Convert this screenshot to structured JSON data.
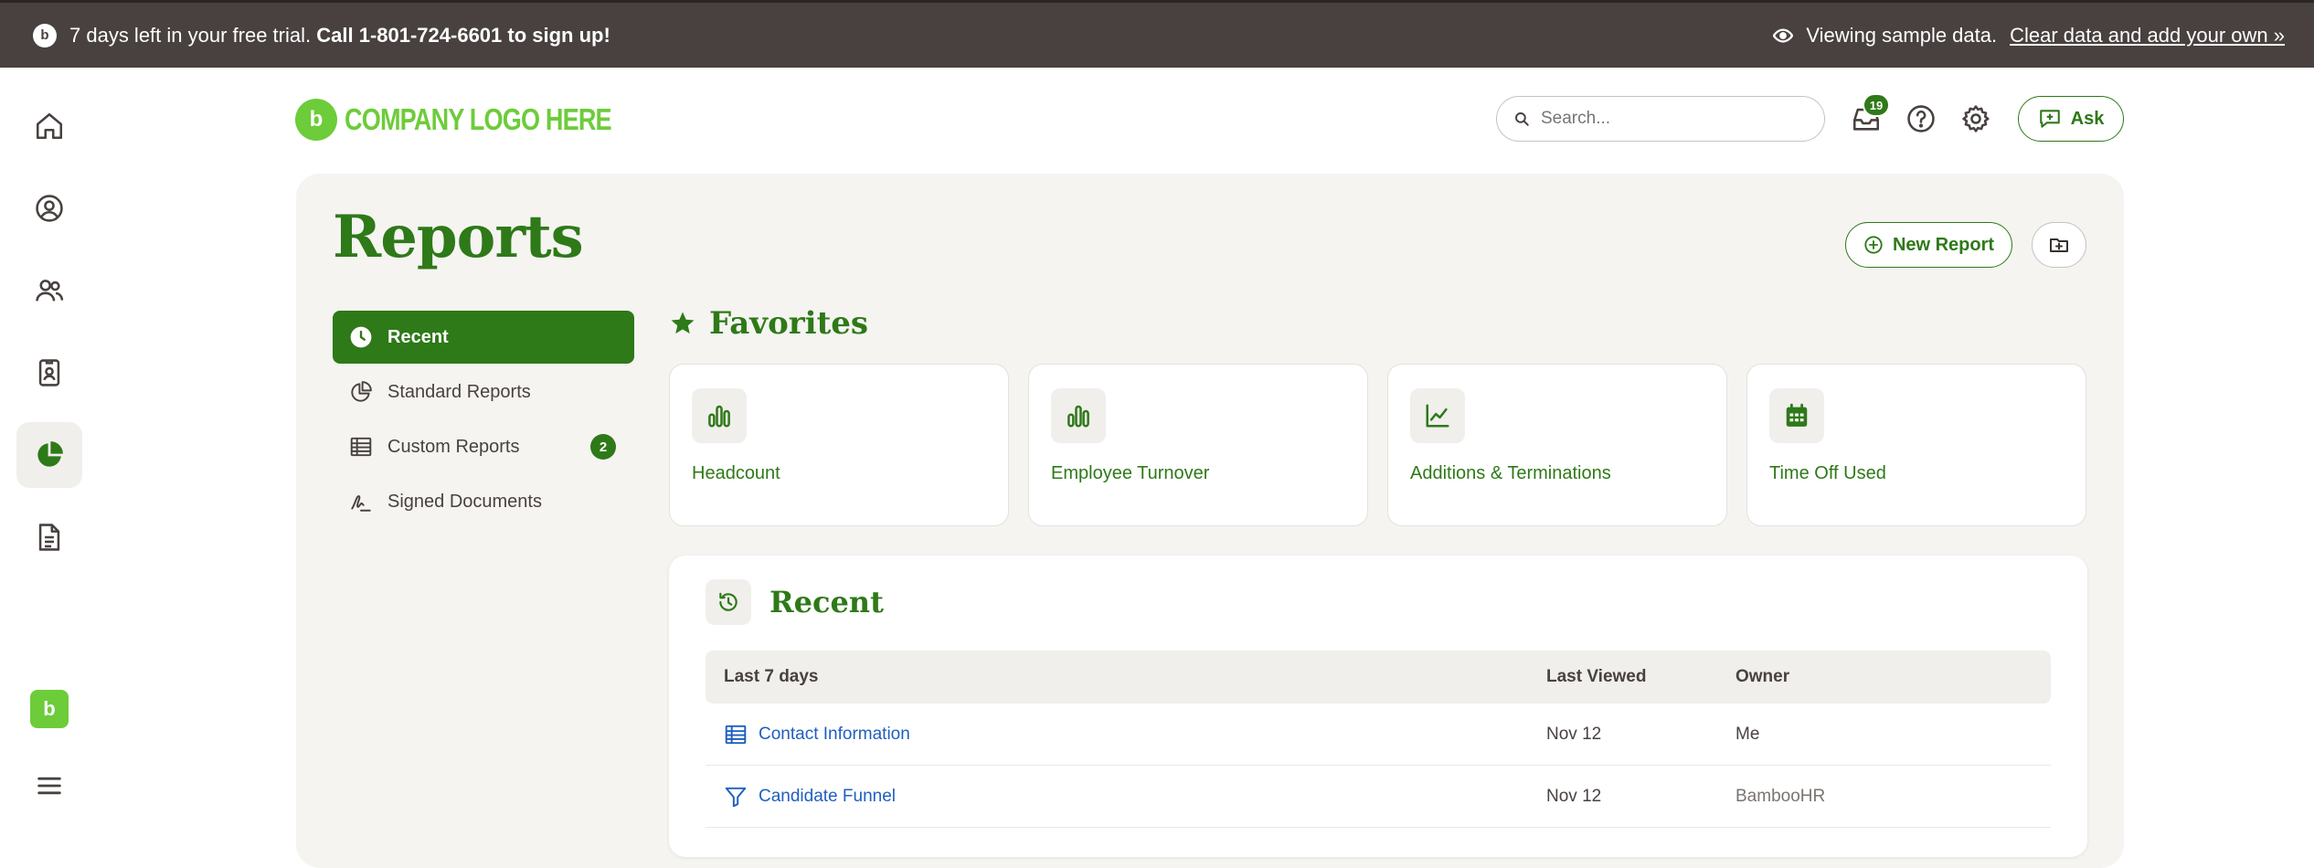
{
  "banner": {
    "trial_text": "7 days left in your free trial.",
    "trial_cta": "Call 1-801-724-6601 to sign up!",
    "sample_text": "Viewing sample data.",
    "sample_link": "Clear data and add your own »"
  },
  "rail": {
    "items": [
      "home",
      "my-info",
      "people",
      "directory",
      "reports",
      "documents"
    ],
    "active": "reports",
    "bottom": [
      "app-switcher",
      "menu"
    ]
  },
  "header": {
    "logo_text": "COMPANY LOGO HERE",
    "search_placeholder": "Search...",
    "inbox_count": "19",
    "ask_label": "Ask"
  },
  "page": {
    "title": "Reports",
    "new_report_label": "New Report"
  },
  "subnav": [
    {
      "label": "Recent",
      "active": true
    },
    {
      "label": "Standard Reports"
    },
    {
      "label": "Custom Reports",
      "badge": "2"
    },
    {
      "label": "Signed Documents"
    }
  ],
  "favorites": {
    "title": "Favorites",
    "cards": [
      {
        "label": "Headcount",
        "icon": "bar-chart-icon"
      },
      {
        "label": "Employee Turnover",
        "icon": "bar-chart-icon"
      },
      {
        "label": "Additions & Terminations",
        "icon": "line-chart-icon"
      },
      {
        "label": "Time Off Used",
        "icon": "calendar-icon"
      }
    ]
  },
  "recent": {
    "title": "Recent",
    "columns": [
      "Last 7 days",
      "Last Viewed",
      "Owner"
    ],
    "rows": [
      {
        "name": "Contact Information",
        "icon": "table-icon",
        "last_viewed": "Nov 12",
        "owner": "Me"
      },
      {
        "name": "Candidate Funnel",
        "icon": "funnel-icon",
        "last_viewed": "Nov 12",
        "owner": "BambooHR"
      }
    ]
  },
  "colors": {
    "brand": "#2e7918",
    "logo": "#6dcc3a",
    "banner": "#48413f",
    "link": "#1f5fbf"
  }
}
